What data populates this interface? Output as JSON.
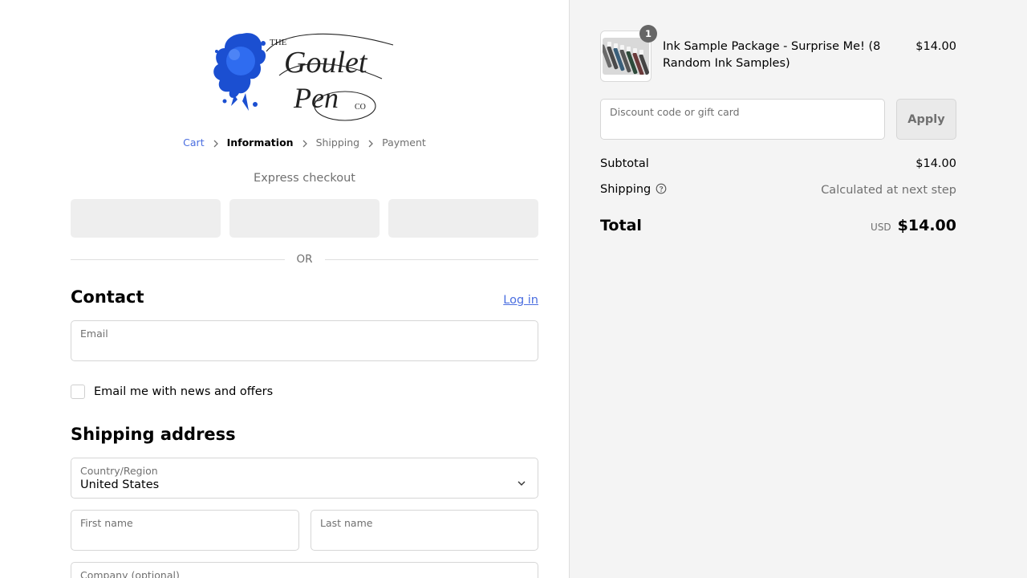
{
  "logo": {
    "text_the": "THE",
    "text_goulet": "Goulet",
    "text_pen": "Pen",
    "text_co": "CO",
    "ink_color": "#1b4fd1"
  },
  "breadcrumb": [
    {
      "label": "Cart",
      "state": "link"
    },
    {
      "label": "Information",
      "state": "active"
    },
    {
      "label": "Shipping",
      "state": "inactive"
    },
    {
      "label": "Payment",
      "state": "inactive"
    }
  ],
  "express": {
    "title": "Express checkout",
    "divider": "OR"
  },
  "contact": {
    "heading": "Contact",
    "login_label": "Log in",
    "email_label": "Email",
    "email_value": "",
    "newsletter_label": "Email me with news and offers",
    "newsletter_checked": false
  },
  "shipping": {
    "heading": "Shipping address",
    "country_label": "Country/Region",
    "country_value": "United States",
    "first_name_label": "First name",
    "last_name_label": "Last name",
    "company_label": "Company (optional)"
  },
  "order": {
    "item": {
      "name": "Ink Sample Package - Surprise Me! (8 Random Ink Samples)",
      "price": "$14.00",
      "quantity": "1"
    },
    "discount_placeholder": "Discount code or gift card",
    "apply_label": "Apply",
    "subtotal_label": "Subtotal",
    "subtotal_value": "$14.00",
    "shipping_label": "Shipping",
    "shipping_value": "Calculated at next step",
    "total_label": "Total",
    "currency": "USD",
    "total_value": "$14.00"
  },
  "colors": {
    "link": "#4a6ee0",
    "panel_bg": "#f4f4f4",
    "muted": "#707070"
  }
}
